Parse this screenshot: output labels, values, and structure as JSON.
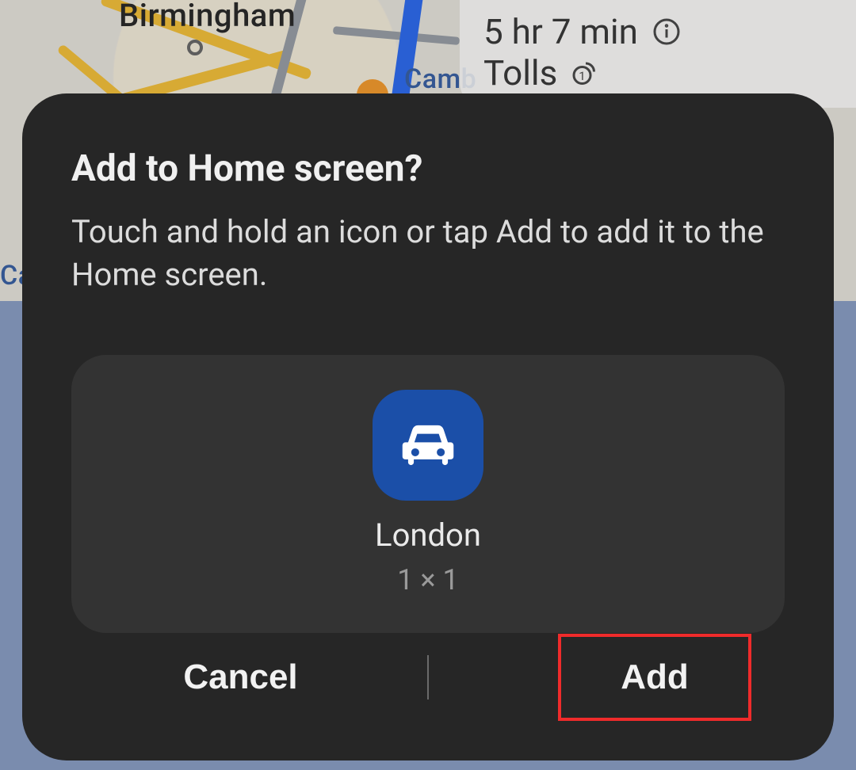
{
  "map": {
    "city_label_1": "Birmingham",
    "city_label_2": "Camb",
    "visible_place": "Ca"
  },
  "route_info": {
    "duration": "5 hr 7 min",
    "tolls_label": "Tolls"
  },
  "dialog": {
    "title": "Add to Home screen?",
    "description": "Touch and hold an icon or tap Add to add it to the Home screen.",
    "shortcut_name": "London",
    "shortcut_size": "1 × 1",
    "cancel_label": "Cancel",
    "add_label": "Add"
  }
}
